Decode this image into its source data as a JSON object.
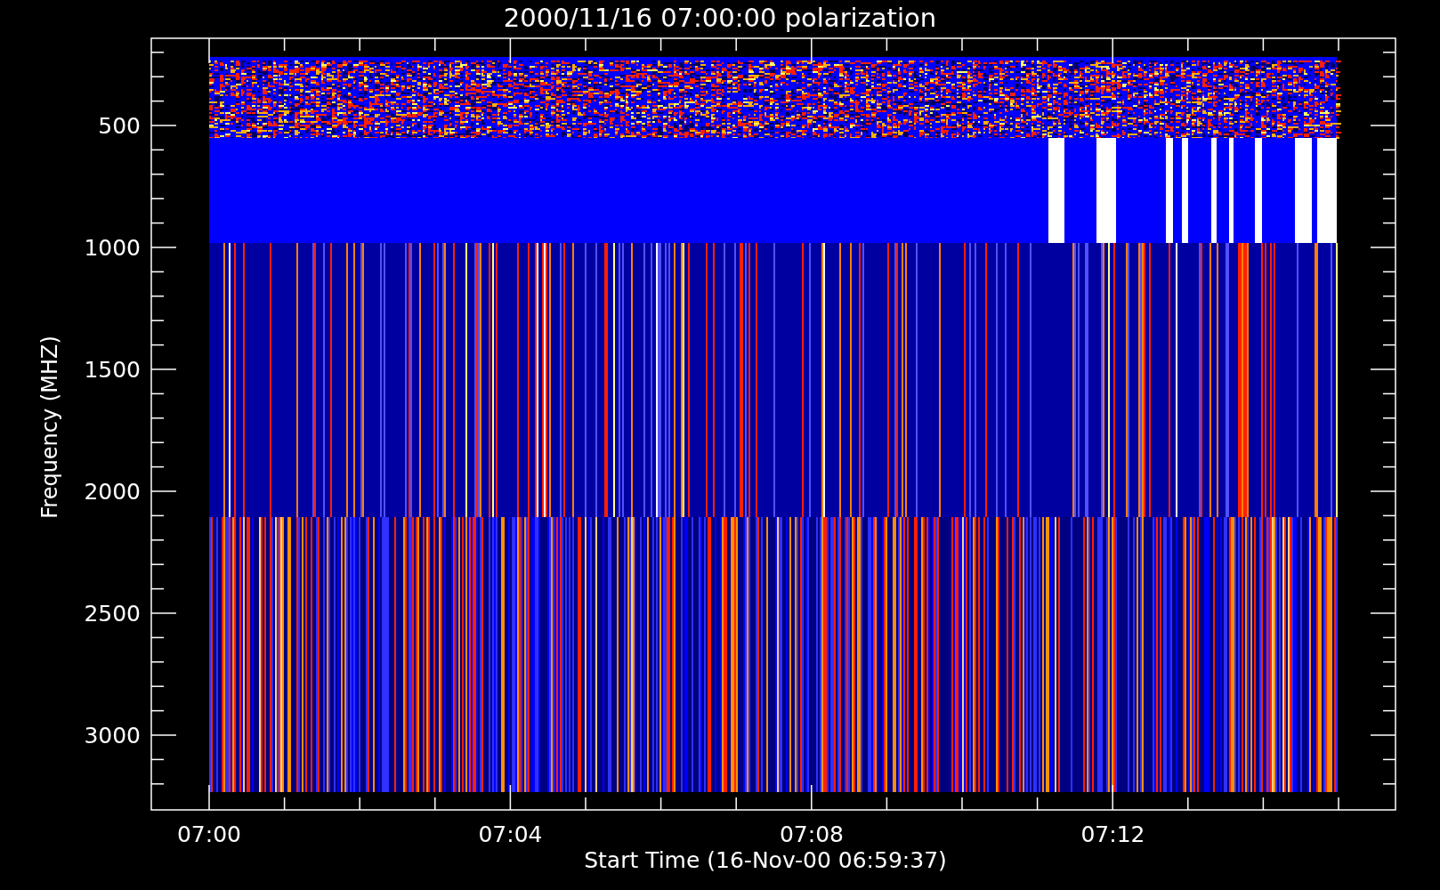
{
  "title": "2000/11/16 07:00:00 polarization",
  "y_axis": {
    "label": "Frequency (MHZ)",
    "ticks": [
      "500",
      "1000",
      "1500",
      "2000",
      "2500",
      "3000"
    ]
  },
  "x_axis": {
    "label": "Start Time (16-Nov-00 06:59:37)",
    "ticks": [
      "07:00",
      "07:04",
      "07:08",
      "07:12"
    ]
  }
}
